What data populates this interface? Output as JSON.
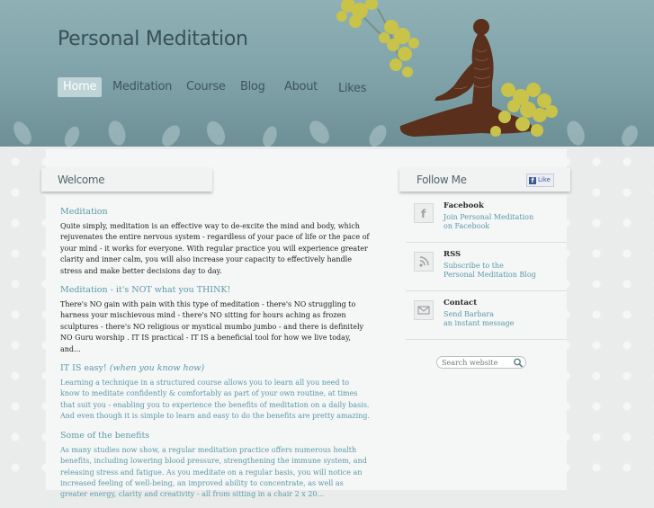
{
  "site": {
    "title": "Personal Meditation"
  },
  "nav": {
    "items": [
      {
        "label": "Home"
      },
      {
        "label": "Meditation"
      },
      {
        "label": "Course"
      },
      {
        "label": "Blog"
      },
      {
        "label": "About"
      },
      {
        "label": "Likes"
      }
    ],
    "active_index": 0
  },
  "welcome": {
    "tab_label": "Welcome",
    "sections": [
      {
        "heading": "Meditation",
        "body": "Quite simply, meditation is an effective way to de-excite the mind and body, which rejuvenates the entire nervous system - regardless of your pace of life or the pace of your mind - it works for everyone. With regular practice you will experience greater clarity and inner calm, you will also increase your capacity to effectively handle stress and make better decisions day to day."
      },
      {
        "heading": "Meditation - it's NOT what you THINK!",
        "body": "There's NO gain with pain with this type of meditation - there's NO struggling to harness your mischievous mind - there's NO sitting for hours aching as frozen sculptures - there's NO religious or mystical mumbo jumbo - and there is definitely NO Guru worship . IT IS practical - IT IS a beneficial tool for how we live today, and..."
      },
      {
        "heading": "IT IS easy!",
        "heading_italic": "(when you know how)",
        "body": "Learning a technique in a structured course allows you to learn all you need to know to meditate confidently & comfortably as part of your own routine, at times that suit you - enabling you to experience the benefits of meditation on a daily basis. And even though it is simple to learn and easy to do the benefits are pretty amazing."
      },
      {
        "heading": "Some of the benefits",
        "body": "As many studies now show, a regular meditation practice offers numerous health benefits, including lowering blood pressure, strengthening the immune system, and releasing stress and fatigue. As you meditate on a regular basis, you will notice an increased feeling of well-being, an improved ability to concentrate, as well as greater energy, clarity and creativity - all from sitting in a chair 2 x 20..."
      }
    ]
  },
  "follow": {
    "tab_label": "Follow Me",
    "like_label": "Like",
    "items": [
      {
        "icon": "facebook-icon",
        "title": "Facebook",
        "line1": "Join Personal Meditation",
        "line2": "on Facebook"
      },
      {
        "icon": "rss-icon",
        "title": "RSS",
        "line1": "Subscribe to the",
        "line2": "Personal Meditation Blog"
      },
      {
        "icon": "mail-icon",
        "title": "Contact",
        "line1": "Send Barbara",
        "line2": "an instant message"
      }
    ]
  },
  "search": {
    "placeholder": "Search website"
  },
  "colors": {
    "header": "#8fb1b6",
    "accent": "#5a9aa9",
    "flower": "#c7c24a",
    "silhouette": "#5a2f1c"
  }
}
